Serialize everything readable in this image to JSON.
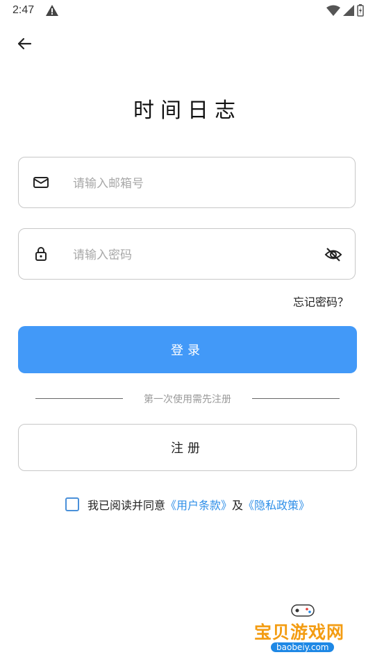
{
  "status_bar": {
    "time": "2:47"
  },
  "page": {
    "title": "时间日志"
  },
  "email": {
    "placeholder": "请输入邮箱号"
  },
  "password": {
    "placeholder": "请输入密码"
  },
  "forgot_password": "忘记密码？",
  "login_label": "登录",
  "divider_text": "第一次使用需先注册",
  "register_label": "注册",
  "agreement": {
    "prefix": "我已阅读并同意",
    "terms_link": "《用户条款》",
    "conjunction": "及",
    "privacy_link": "《隐私政策》"
  },
  "watermark": {
    "name": "宝贝游戏网",
    "domain": "baobeiy.com"
  },
  "colors": {
    "accent": "#4299f8",
    "link": "#2f8fe8",
    "border": "#c7c7c7"
  }
}
